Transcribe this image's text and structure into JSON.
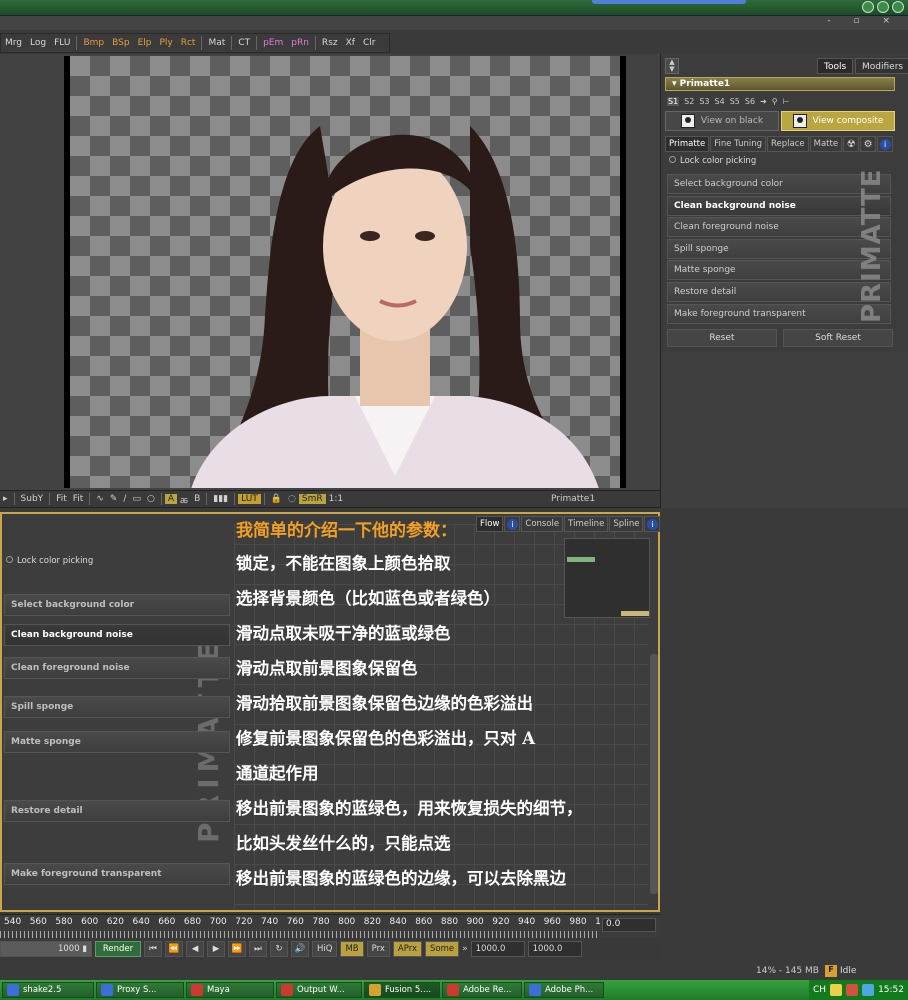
{
  "toolbar": {
    "buttons": [
      {
        "label": "Mrg",
        "color": "#d8d8d8"
      },
      {
        "label": "Log",
        "color": "#d8d8d8"
      },
      {
        "label": "FLU",
        "color": "#d8d8d8"
      },
      {
        "label": "Bmp",
        "color": "#e8a040"
      },
      {
        "label": "BSp",
        "color": "#e8a040"
      },
      {
        "label": "Elp",
        "color": "#e8a040"
      },
      {
        "label": "Ply",
        "color": "#e8a040"
      },
      {
        "label": "Rct",
        "color": "#e8a040"
      },
      {
        "label": "Mat",
        "color": "#d8d8d8"
      },
      {
        "label": "CT",
        "color": "#d8d8d8"
      },
      {
        "label": "pEm",
        "color": "#e07cd6"
      },
      {
        "label": "pRn",
        "color": "#e07cd6"
      },
      {
        "label": "Rsz",
        "color": "#d8d8d8"
      },
      {
        "label": "Xf",
        "color": "#d8d8d8"
      },
      {
        "label": "Clr",
        "color": "#d8d8d8"
      }
    ]
  },
  "viewer": {
    "bar": {
      "suby": "SubY",
      "fit1": "Fit",
      "fit2": "Fit",
      "a": "A",
      "b": "B",
      "lut": "LUT",
      "smr": "SmR",
      "ratio": "1:1",
      "title": "Primatte1"
    }
  },
  "right_panel": {
    "tabs": {
      "tools": "Tools",
      "modifiers": "Modifiers"
    },
    "header": "Primatte1",
    "slots": [
      "S1",
      "S2",
      "S3",
      "S4",
      "S5",
      "S6"
    ],
    "view_modes": {
      "black": "View on black",
      "composite": "View composite"
    },
    "subtabs": [
      "Primatte",
      "Fine Tuning",
      "Replace",
      "Matte"
    ],
    "lock_label": "Lock color picking",
    "buttons": [
      "Select background color",
      "Clean background noise",
      "Clean foreground noise",
      "Spill sponge",
      "Matte sponge",
      "Restore detail",
      "Make foreground transparent"
    ],
    "vertical_logo": "PRIMATTE",
    "reset": "Reset",
    "soft_reset": "Soft Reset"
  },
  "bottom_panel": {
    "tabs": [
      "Flow",
      "Console",
      "Timeline",
      "Spline"
    ],
    "lock_label": "Lock color picking",
    "buttons": [
      "Select background color",
      "Clean background noise",
      "Clean foreground noise",
      "Spill sponge",
      "Matte sponge",
      "Restore detail",
      "Make foreground transparent"
    ],
    "vertical_logo": "PRIMATTE"
  },
  "overlay_text": {
    "heading": "我简单的介绍一下他的参数：",
    "lines": [
      "锁定，不能在图象上颜色拾取",
      "选择背景颜色（比如蓝色或者绿色）",
      "滑动点取未吸干净的蓝或绿色",
      "滑动点取前景图象保留色",
      "滑动拾取前景图象保留色边缘的色彩溢出",
      "修复前景图象保留色的色彩溢出，只对 A",
      "通道起作用",
      "移出前景图象的蓝绿色，用来恢复损失的细节，",
      "比如头发丝什么的，只能点选",
      "移出前景图象的蓝绿色的边缘，可以去除黑边"
    ]
  },
  "timeline": {
    "ticks": [
      "540",
      "560",
      "580",
      "600",
      "620",
      "640",
      "660",
      "680",
      "700",
      "720",
      "740",
      "760",
      "780",
      "800",
      "820",
      "840",
      "860",
      "880",
      "900",
      "920",
      "940",
      "960",
      "980",
      "1"
    ],
    "current": "0.0"
  },
  "transport": {
    "frame": "1000",
    "render": "Render",
    "hiq": "HiQ",
    "mb": "MB",
    "prx": "Prx",
    "aprx": "APrx",
    "some": "Some",
    "start": "1000.0",
    "end": "1000.0"
  },
  "status": {
    "memory": "14% - 145 MB",
    "state": "Idle"
  },
  "taskbar": {
    "items": [
      {
        "label": "shake2.5",
        "color": "#3b6fd8"
      },
      {
        "label": "Proxy S...",
        "color": "#3b6fd8"
      },
      {
        "label": "Maya",
        "color": "#c93a2f"
      },
      {
        "label": "Output W...",
        "color": "#c93a2f"
      },
      {
        "label": "Fusion 5....",
        "color": "#d6a12f"
      },
      {
        "label": "Adobe Re...",
        "color": "#c93a2f"
      },
      {
        "label": "Adobe Ph...",
        "color": "#3b6fd8"
      }
    ],
    "tray_lang": "CH",
    "clock": "15:52"
  }
}
